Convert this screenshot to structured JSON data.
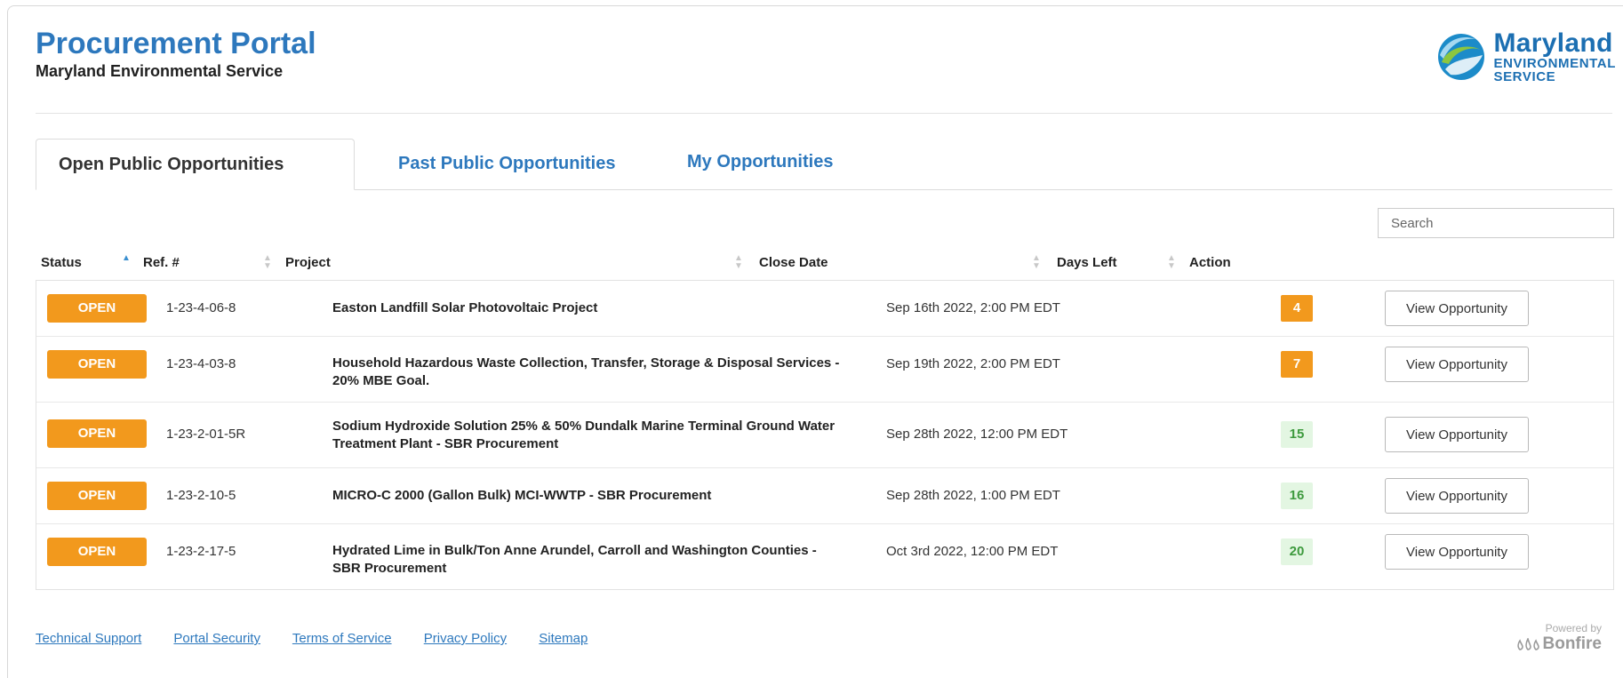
{
  "header": {
    "title": "Procurement Portal",
    "subtitle": "Maryland Environmental Service",
    "logo_line1": "Maryland",
    "logo_line2": "ENVIRONMENTAL",
    "logo_line3": "SERVICE"
  },
  "tabs": [
    {
      "label": "Open Public Opportunities",
      "active": true
    },
    {
      "label": "Past Public Opportunities",
      "active": false
    },
    {
      "label": "My Opportunities",
      "active": false
    }
  ],
  "search": {
    "placeholder": "Search"
  },
  "table": {
    "columns": [
      "Status",
      "Ref. #",
      "Project",
      "Close Date",
      "Days Left",
      "Action"
    ],
    "sorted_column": "Status",
    "rows": [
      {
        "status": "OPEN",
        "ref": "1-23-4-06-8",
        "project": "Easton Landfill Solar Photovoltaic Project",
        "close_date": "Sep 16th 2022, 2:00 PM EDT",
        "days_left": "4",
        "days_color": "orange",
        "action": "View Opportunity"
      },
      {
        "status": "OPEN",
        "ref": "1-23-4-03-8",
        "project": "Household Hazardous Waste Collection, Transfer, Storage & Disposal Services - 20% MBE Goal.",
        "close_date": "Sep 19th 2022, 2:00 PM EDT",
        "days_left": "7",
        "days_color": "orange",
        "action": "View Opportunity"
      },
      {
        "status": "OPEN",
        "ref": "1-23-2-01-5R",
        "project": "Sodium Hydroxide Solution 25% & 50% Dundalk Marine Terminal Ground Water Treatment Plant - SBR Procurement",
        "close_date": "Sep 28th 2022, 12:00 PM EDT",
        "days_left": "15",
        "days_color": "green",
        "action": "View Opportunity"
      },
      {
        "status": "OPEN",
        "ref": "1-23-2-10-5",
        "project": "MICRO-C 2000 (Gallon Bulk) MCI-WWTP - SBR Procurement",
        "close_date": "Sep 28th 2022, 1:00 PM EDT",
        "days_left": "16",
        "days_color": "green",
        "action": "View Opportunity"
      },
      {
        "status": "OPEN",
        "ref": "1-23-2-17-5",
        "project": "Hydrated Lime in Bulk/Ton Anne Arundel, Carroll and Washington Counties - SBR Procurement",
        "close_date": "Oct 3rd 2022, 12:00 PM EDT",
        "days_left": "20",
        "days_color": "green",
        "action": "View Opportunity"
      }
    ]
  },
  "footer": {
    "links": [
      "Technical Support",
      "Portal Security",
      "Terms of Service",
      "Privacy Policy",
      "Sitemap"
    ],
    "powered_by": "Powered by",
    "brand": "Bonfire"
  },
  "colors": {
    "accent_blue": "#2d78bd",
    "open_orange": "#f2991d",
    "days_green_bg": "#e3f6e2",
    "days_green_text": "#3d9a3d"
  },
  "icons": {
    "logo": "mes-swirl-logo-icon",
    "sort": "sort-arrows-icon",
    "brand": "bonfire-flames-icon"
  }
}
